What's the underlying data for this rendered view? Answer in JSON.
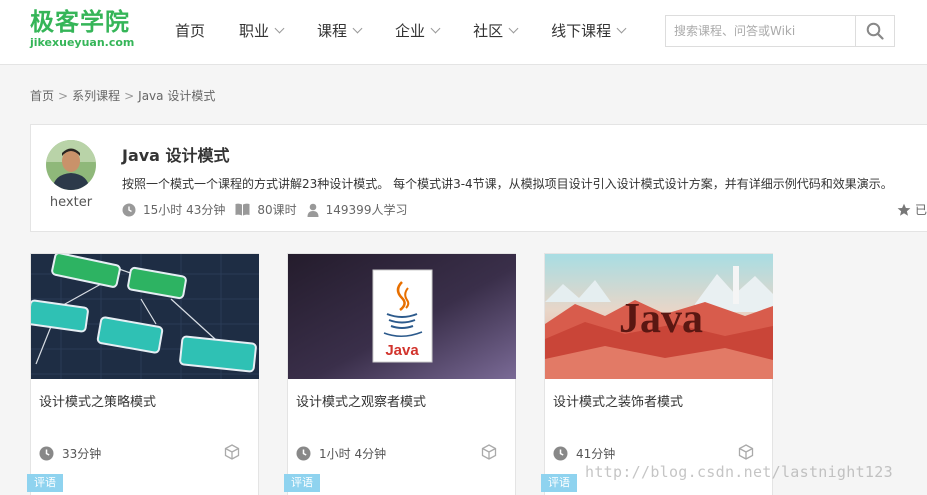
{
  "header": {
    "logo_cn": "极客学院",
    "logo_en": "jikexueyuan.com",
    "nav": [
      {
        "label": "首页",
        "has_dropdown": false
      },
      {
        "label": "职业",
        "has_dropdown": true
      },
      {
        "label": "课程",
        "has_dropdown": true
      },
      {
        "label": "企业",
        "has_dropdown": true
      },
      {
        "label": "社区",
        "has_dropdown": true
      },
      {
        "label": "线下课程",
        "has_dropdown": true
      }
    ],
    "search_placeholder": "搜索课程、问答或Wiki",
    "search_value": ""
  },
  "breadcrumb": {
    "items": [
      "首页",
      "系列课程",
      "Java 设计模式"
    ],
    "separator": ">"
  },
  "course": {
    "author": "hexter",
    "title": "Java 设计模式",
    "description": "按照一个模式一个课程的方式讲解23种设计模式。 每个模式讲3-4节课，从模拟项目设计引入设计模式设计方案，并有详细示例代码和效果演示。",
    "duration": "15小时 43分钟",
    "lessons": "80课时",
    "learners": "149399人学习",
    "fav_label": "已"
  },
  "cards": [
    {
      "title": "设计模式之策略模式",
      "duration": "33分钟",
      "tag": "评语",
      "thumb": "strategy-diagram"
    },
    {
      "title": "设计模式之观察者模式",
      "duration": "1小时 4分钟",
      "tag": "评语",
      "thumb": "java-logo"
    },
    {
      "title": "设计模式之装饰者模式",
      "duration": "41分钟",
      "tag": "评语",
      "thumb": "java-landscape"
    }
  ],
  "thumb_texts": {
    "java_logo": "Java",
    "java_landscape": "Java"
  },
  "watermark": "http://blog.csdn.net/lastnight123",
  "colors": {
    "brand": "#35b558",
    "tag": "#8fd3ef"
  }
}
